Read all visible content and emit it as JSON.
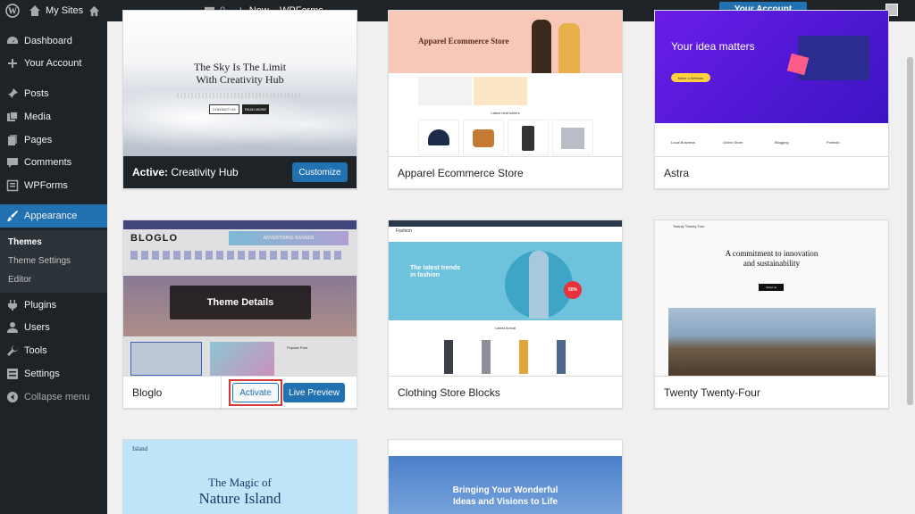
{
  "adminbar": {
    "site_name": "My Sites",
    "comments_count": "0",
    "new_label": "New",
    "wpforms_label": "WPForms",
    "account_button": "Your Account"
  },
  "sidebar": {
    "items": [
      {
        "label": "Dashboard",
        "icon": "dashboard-icon"
      },
      {
        "label": "Your Account",
        "icon": "plus-icon"
      },
      {
        "label": "Posts",
        "icon": "pin-icon"
      },
      {
        "label": "Media",
        "icon": "media-icon"
      },
      {
        "label": "Pages",
        "icon": "pages-icon"
      },
      {
        "label": "Comments",
        "icon": "comments-icon"
      },
      {
        "label": "WPForms",
        "icon": "forms-icon"
      },
      {
        "label": "Appearance",
        "icon": "brush-icon"
      },
      {
        "label": "Plugins",
        "icon": "plug-icon"
      },
      {
        "label": "Users",
        "icon": "users-icon"
      },
      {
        "label": "Tools",
        "icon": "wrench-icon"
      },
      {
        "label": "Settings",
        "icon": "settings-icon"
      },
      {
        "label": "Collapse menu",
        "icon": "collapse-icon"
      }
    ],
    "submenu": [
      "Themes",
      "Theme Settings",
      "Editor"
    ]
  },
  "themes": {
    "creativity": {
      "active_prefix": "Active:",
      "name": "Creativity Hub",
      "customize": "Customize",
      "hero1": "The Sky Is The Limit",
      "hero2": "With Creativity Hub",
      "btn1": "CONTACT US",
      "btn2": "READ MORE"
    },
    "apparel": {
      "name": "Apparel Ecommerce Store",
      "hero": "Apparel Ecommerce Store",
      "sub": "Latest best sellers"
    },
    "astra": {
      "name": "Astra",
      "hero": "Your idea matters",
      "cta": "Make a Website",
      "features": [
        "Local Business",
        "Online Store",
        "Blogging",
        "Portfolio"
      ]
    },
    "bloglo": {
      "name": "Bloglo",
      "logo": "BLOGLO",
      "banner": "ADVERTISING BANNER",
      "details": "Theme Details",
      "activate": "Activate",
      "preview": "Live Preview",
      "popular": "Popular Post"
    },
    "clothing": {
      "name": "Clothing Store Blocks",
      "brand": "Fashion",
      "hero1": "The latest trends",
      "hero2": "in fashion",
      "badge": "50%",
      "arrival": "Latest Arrival"
    },
    "tt4": {
      "name": "Twenty Twenty-Four",
      "brand": "Twenty Twenty Four",
      "hero1": "A commitment to innovation",
      "hero2": "and sustainability",
      "about": "About us"
    },
    "island": {
      "brand": "Island",
      "hero1": "The Magic of",
      "hero2": "Nature Island"
    },
    "wonderful": {
      "hero1": "Bringing Your Wonderful",
      "hero2": "Ideas and Visions to Life"
    }
  },
  "colors": {
    "admin_dark": "#1d2327",
    "accent": "#2271b1",
    "highlight_red": "#d63638"
  }
}
